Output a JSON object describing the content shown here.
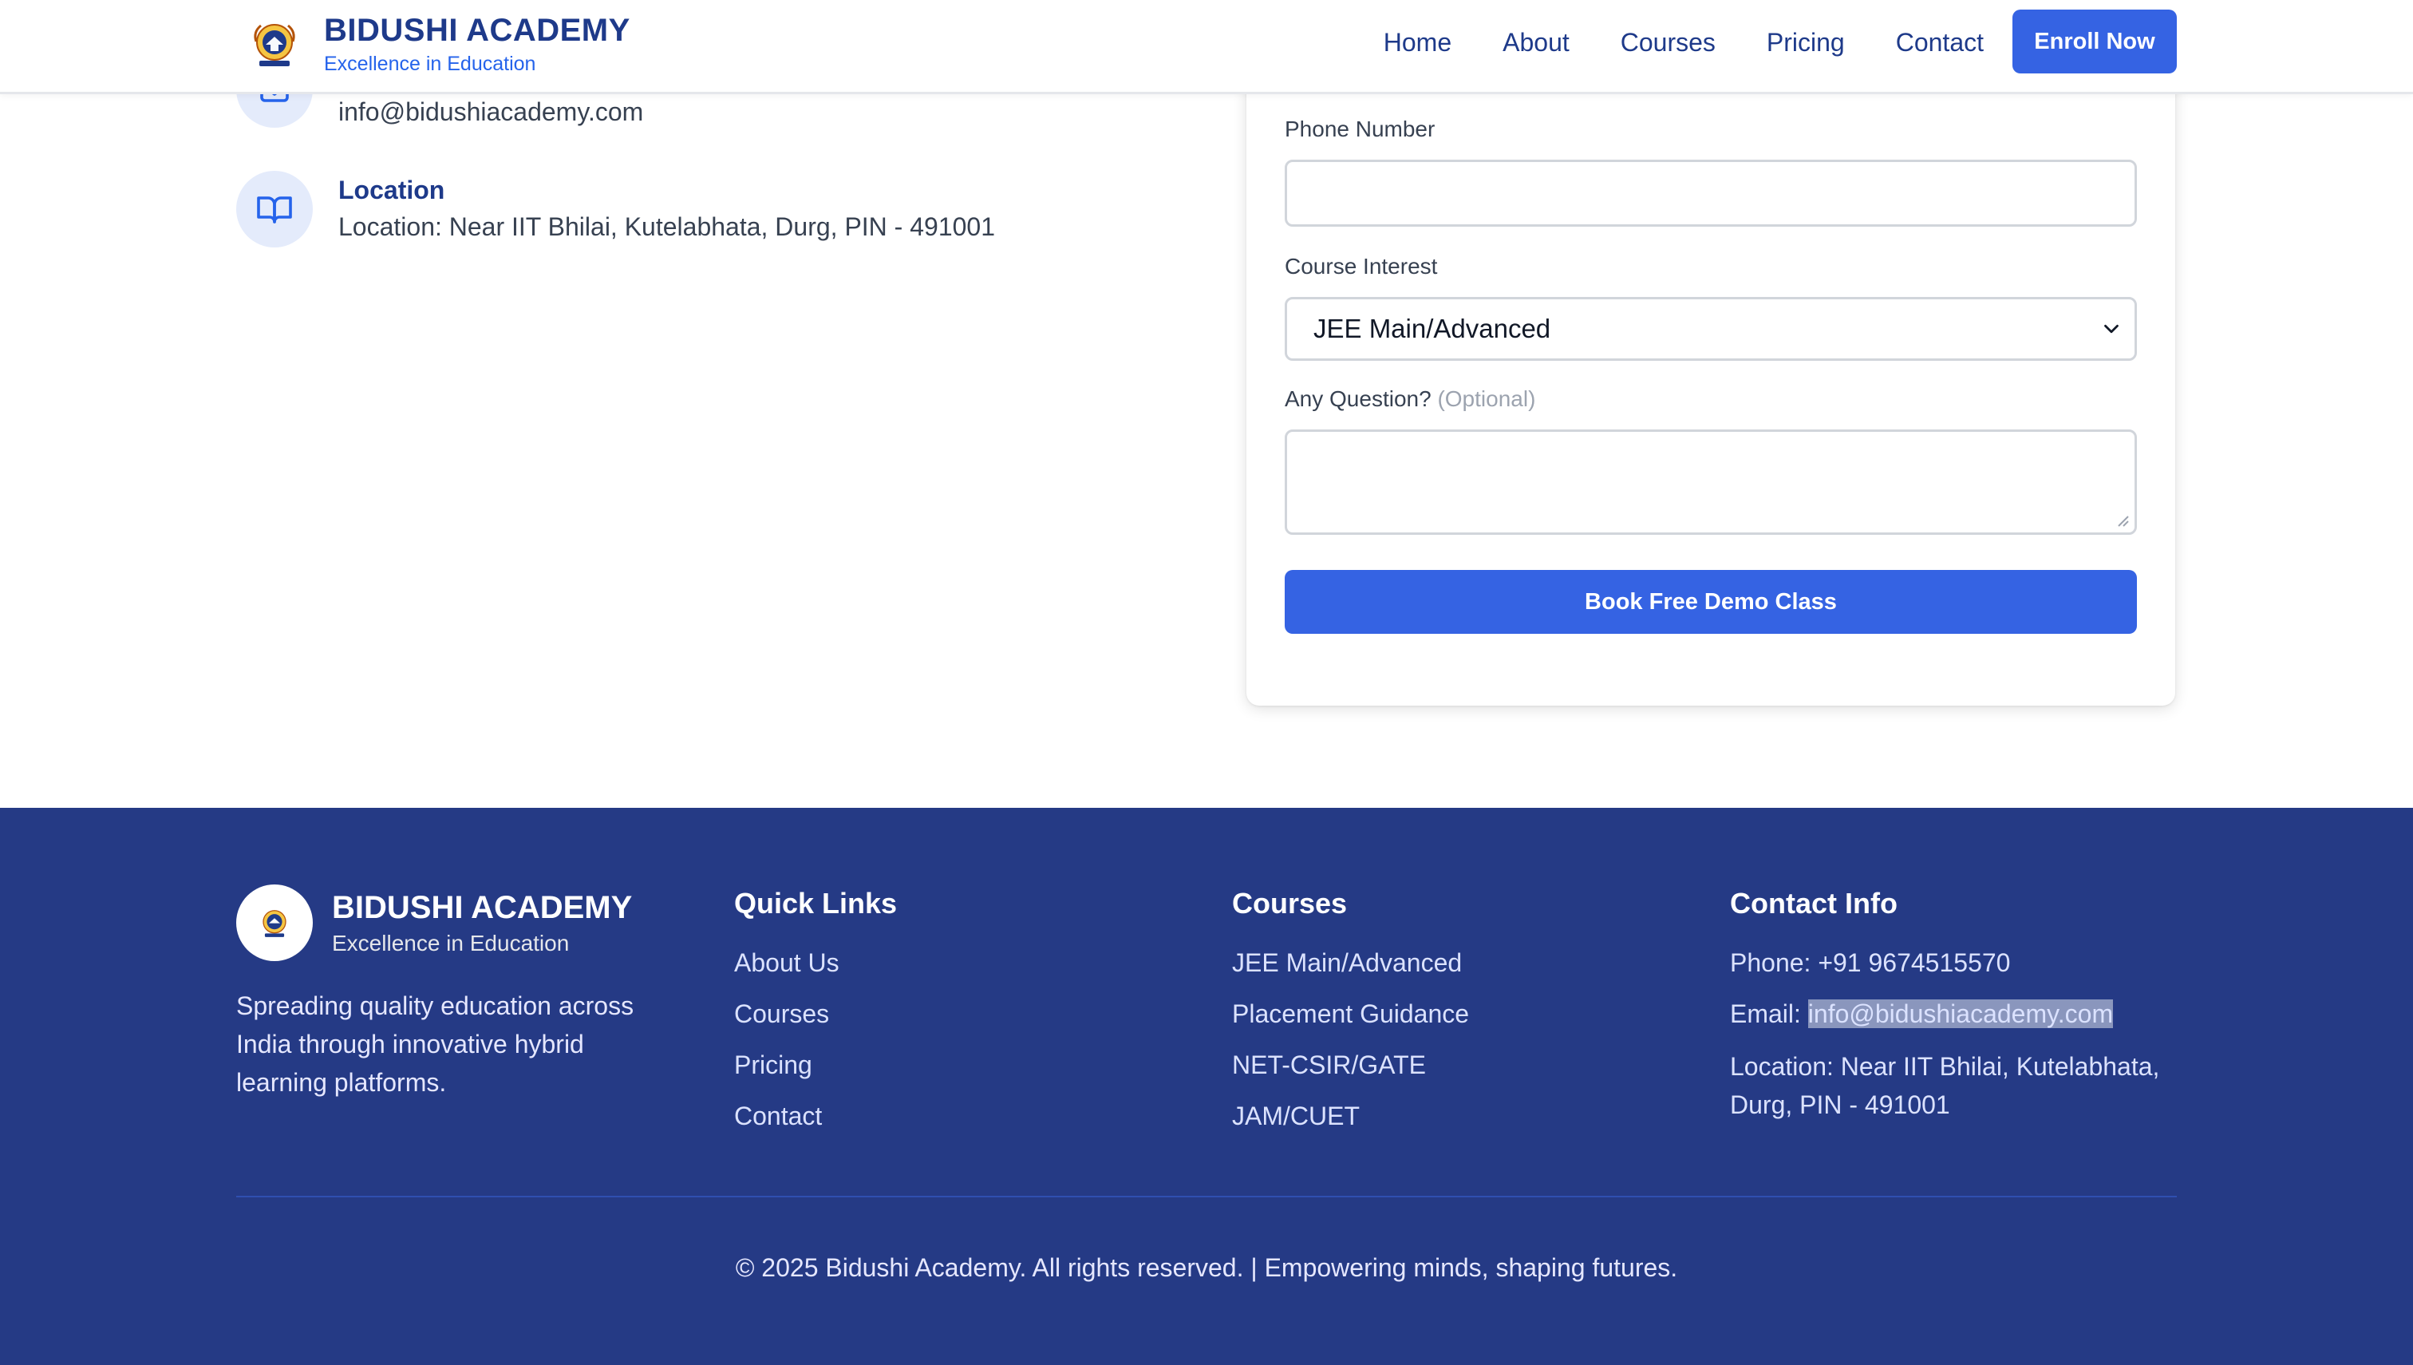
{
  "header": {
    "brand_name": "BIDUSHI ACADEMY",
    "brand_tagline": "Excellence in Education",
    "nav": [
      "Home",
      "About",
      "Courses",
      "Pricing",
      "Contact"
    ],
    "cta_label": "Enroll Now"
  },
  "contact": {
    "email_value": "info@bidushiacademy.com",
    "location_label": "Location",
    "location_value": "Location: Near IIT Bhilai, Kutelabhata, Durg, PIN - 491001"
  },
  "form": {
    "phone_label": "Phone Number",
    "phone_value": "",
    "course_label": "Course Interest",
    "course_selected": "JEE Main/Advanced",
    "question_label": "Any Question?",
    "question_optional": "(Optional)",
    "question_value": "",
    "submit_label": "Book Free Demo Class"
  },
  "footer": {
    "brand_name": "BIDUSHI ACADEMY",
    "brand_tagline": "Excellence in Education",
    "description": "Spreading quality education across India through innovative hybrid learning platforms.",
    "quick_links_title": "Quick Links",
    "quick_links": [
      "About Us",
      "Courses",
      "Pricing",
      "Contact"
    ],
    "courses_title": "Courses",
    "courses": [
      "JEE Main/Advanced",
      "Placement Guidance",
      "NET-CSIR/GATE",
      "JAM/CUET"
    ],
    "contact_title": "Contact Info",
    "phone": "Phone: +91 9674515570",
    "email_prefix": "Email: ",
    "email": "info@bidushiacademy.com",
    "location": "Location: Near IIT Bhilai, Kutelabhata, Durg, PIN - 491001",
    "copyright": "© 2025 Bidushi Academy. All rights reserved. | Empowering minds, shaping futures."
  },
  "colors": {
    "primary": "#3563e3",
    "navy": "#1e3a8a",
    "footer_bg": "#253a85"
  },
  "icons": [
    "academy-logo-icon",
    "mail-icon",
    "book-open-icon",
    "chevron-down-icon"
  ]
}
